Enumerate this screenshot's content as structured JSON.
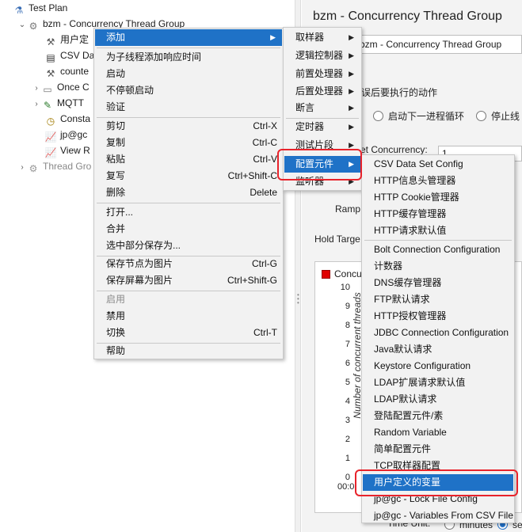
{
  "tree": {
    "items": [
      {
        "label": "Test Plan",
        "icon": "test-plan-icon"
      },
      {
        "label": "bzm - Concurrency Thread Group",
        "icon": "gear-icon"
      },
      {
        "label": "用户定",
        "icon": "tools-icon"
      },
      {
        "label": "CSV Da",
        "icon": "csv-icon"
      },
      {
        "label": "counte",
        "icon": "tools-icon"
      },
      {
        "label": "Once C",
        "icon": "controller-icon"
      },
      {
        "label": "MQTT",
        "icon": "pipette-icon"
      },
      {
        "label": "Consta",
        "icon": "timer-icon"
      },
      {
        "label": "jp@gc",
        "icon": "graph-icon"
      },
      {
        "label": "View R",
        "icon": "graph-icon"
      },
      {
        "label": "Thread Gro",
        "icon": "gear-icon"
      }
    ]
  },
  "right_panel": {
    "title": "bzm - Concurrency Thread Group",
    "name_value": "bzm - Concurrency Thread Group",
    "error_action_label": "误后要执行的动作",
    "radio_next_loop": "启动下一进程循环",
    "radio_stop": "停止线",
    "target_concurrency_label": "et Concurrency:",
    "target_concurrency_value": "1",
    "ramp_label": "Ramp",
    "hold_label": "Hold Targe",
    "chart": {
      "legend": "Concur",
      "ylabel": "Number of concurrent threads",
      "yticks": [
        "10",
        "9",
        "8",
        "7",
        "6",
        "5",
        "4",
        "3",
        "2",
        "1",
        "0"
      ],
      "xtick": "00:0"
    },
    "time_unit_label": "Time Unit:",
    "minutes_label": "minutes",
    "seconds_label": "se"
  },
  "menu_main": {
    "items": [
      {
        "label": "添加",
        "submenu": true,
        "highlighted": true
      },
      {
        "label": "为子线程添加响应时间"
      },
      {
        "label": "启动"
      },
      {
        "label": "不停顿启动"
      },
      {
        "label": "验证"
      },
      {
        "label": "剪切",
        "shortcut": "Ctrl-X"
      },
      {
        "label": "复制",
        "shortcut": "Ctrl-C"
      },
      {
        "label": "粘贴",
        "shortcut": "Ctrl-V"
      },
      {
        "label": "复写",
        "shortcut": "Ctrl+Shift-C"
      },
      {
        "label": "删除",
        "shortcut": "Delete"
      },
      {
        "label": "打开..."
      },
      {
        "label": "合并"
      },
      {
        "label": "选中部分保存为..."
      },
      {
        "label": "保存节点为图片",
        "shortcut": "Ctrl-G"
      },
      {
        "label": "保存屏幕为图片",
        "shortcut": "Ctrl+Shift-G"
      },
      {
        "label": "启用",
        "disabled": true
      },
      {
        "label": "禁用"
      },
      {
        "label": "切换",
        "shortcut": "Ctrl-T"
      },
      {
        "label": "帮助"
      }
    ]
  },
  "menu_add": {
    "items": [
      {
        "label": "取样器"
      },
      {
        "label": "逻辑控制器"
      },
      {
        "label": "前置处理器"
      },
      {
        "label": "后置处理器"
      },
      {
        "label": "断言"
      },
      {
        "label": "定时器"
      },
      {
        "label": "测试片段"
      },
      {
        "label": "配置元件",
        "highlighted": true
      },
      {
        "label": "监听器"
      }
    ]
  },
  "menu_config": {
    "items": [
      {
        "label": "CSV Data Set Config"
      },
      {
        "label": "HTTP信息头管理器"
      },
      {
        "label": "HTTP Cookie管理器"
      },
      {
        "label": "HTTP缓存管理器"
      },
      {
        "label": "HTTP请求默认值"
      },
      {
        "label": "Bolt Connection Configuration"
      },
      {
        "label": "计数器"
      },
      {
        "label": "DNS缓存管理器"
      },
      {
        "label": "FTP默认请求"
      },
      {
        "label": "HTTP授权管理器"
      },
      {
        "label": "JDBC Connection Configuration"
      },
      {
        "label": "Java默认请求"
      },
      {
        "label": "Keystore Configuration"
      },
      {
        "label": "LDAP扩展请求默认值"
      },
      {
        "label": "LDAP默认请求"
      },
      {
        "label": "登陆配置元件/素"
      },
      {
        "label": "Random Variable"
      },
      {
        "label": "简单配置元件"
      },
      {
        "label": "TCP取样器配置"
      },
      {
        "label": "用户定义的变量",
        "highlighted": true
      },
      {
        "label": "jp@gc - Lock File Config"
      },
      {
        "label": "jp@gc - Variables From CSV File"
      }
    ]
  },
  "colors": {
    "highlight": "#1f72c7",
    "annotation_red": "#e8232b",
    "legend_red": "#e00000"
  }
}
